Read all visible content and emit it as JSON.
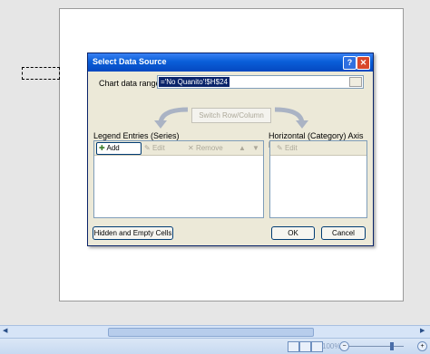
{
  "dialog": {
    "title": "Select Data Source",
    "help_glyph": "?",
    "close_glyph": "✕",
    "range_label": "Chart data range:",
    "range_value": "='No Quanito'!$H$24",
    "switch_label": "Switch Row/Column",
    "legend_label": "Legend Entries (Series)",
    "axis_label": "Horizontal (Category) Axis Labels",
    "legend_toolbar": {
      "add": "Add",
      "edit": "Edit",
      "remove": "Remove",
      "up": "▲",
      "down": "▼"
    },
    "axis_toolbar": {
      "edit": "Edit"
    },
    "hidden_button": "Hidden and Empty Cells",
    "ok_button": "OK",
    "cancel_button": "Cancel"
  },
  "statusbar": {
    "zoom_level": "100%",
    "zoom_minus": "−",
    "zoom_plus": "+"
  },
  "hscroll": {
    "left": "◀",
    "right": "▶"
  },
  "colors": {
    "titlebar": "#0a5ed8",
    "dialog_bg": "#ece9d8",
    "selection": "#0a246a"
  }
}
